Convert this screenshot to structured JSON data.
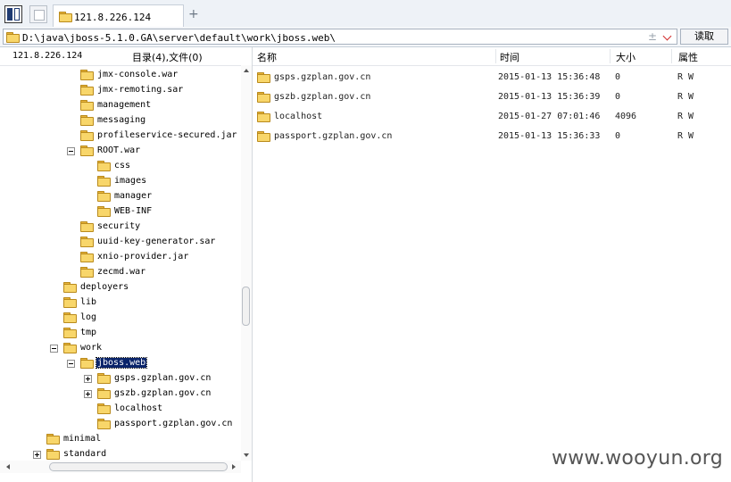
{
  "tab": {
    "title": "121.8.226.124",
    "add_icon": "+"
  },
  "address": {
    "path": "D:\\java\\jboss-5.1.0.GA\\server\\default\\work\\jboss.web\\",
    "plus_icon": "±",
    "read_button": "读取"
  },
  "left_panel": {
    "host": "121.8.226.124",
    "count_label": "目录(4),文件(0)",
    "tree": [
      {
        "label": "jmx-console.war",
        "depth": 2,
        "expander": null
      },
      {
        "label": "jmx-remoting.sar",
        "depth": 2,
        "expander": null
      },
      {
        "label": "management",
        "depth": 2,
        "expander": null
      },
      {
        "label": "messaging",
        "depth": 2,
        "expander": null
      },
      {
        "label": "profileservice-secured.jar",
        "depth": 2,
        "expander": null
      },
      {
        "label": "ROOT.war",
        "depth": 2,
        "expander": "minus"
      },
      {
        "label": "css",
        "depth": 3,
        "expander": null
      },
      {
        "label": "images",
        "depth": 3,
        "expander": null
      },
      {
        "label": "manager",
        "depth": 3,
        "expander": null
      },
      {
        "label": "WEB-INF",
        "depth": 3,
        "expander": null
      },
      {
        "label": "security",
        "depth": 2,
        "expander": null
      },
      {
        "label": "uuid-key-generator.sar",
        "depth": 2,
        "expander": null
      },
      {
        "label": "xnio-provider.jar",
        "depth": 2,
        "expander": null
      },
      {
        "label": "zecmd.war",
        "depth": 2,
        "expander": null
      },
      {
        "label": "deployers",
        "depth": 1,
        "expander": null
      },
      {
        "label": "lib",
        "depth": 1,
        "expander": null
      },
      {
        "label": "log",
        "depth": 1,
        "expander": null
      },
      {
        "label": "tmp",
        "depth": 1,
        "expander": null
      },
      {
        "label": "work",
        "depth": 1,
        "expander": "minus"
      },
      {
        "label": "jboss.web",
        "depth": 2,
        "expander": "minus",
        "selected": true
      },
      {
        "label": "gsps.gzplan.gov.cn",
        "depth": 3,
        "expander": "plus"
      },
      {
        "label": "gszb.gzplan.gov.cn",
        "depth": 3,
        "expander": "plus"
      },
      {
        "label": "localhost",
        "depth": 3,
        "expander": null
      },
      {
        "label": "passport.gzplan.gov.cn",
        "depth": 3,
        "expander": null
      },
      {
        "label": "minimal",
        "depth": 0,
        "expander": null
      },
      {
        "label": "standard",
        "depth": 0,
        "expander": "plus"
      }
    ]
  },
  "file_list": {
    "columns": {
      "name": "名称",
      "time": "时间",
      "size": "大小",
      "attr": "属性"
    },
    "rows": [
      {
        "name": "gsps.gzplan.gov.cn",
        "time": "2015-01-13 15:36:48",
        "size": "0",
        "attr": "R W"
      },
      {
        "name": "gszb.gzplan.gov.cn",
        "time": "2015-01-13 15:36:39",
        "size": "0",
        "attr": "R W"
      },
      {
        "name": "localhost",
        "time": "2015-01-27 07:01:46",
        "size": "4096",
        "attr": "R W"
      },
      {
        "name": "passport.gzplan.gov.cn",
        "time": "2015-01-13 15:36:33",
        "size": "0",
        "attr": "R W"
      }
    ]
  },
  "watermark": "www.wooyun.org"
}
